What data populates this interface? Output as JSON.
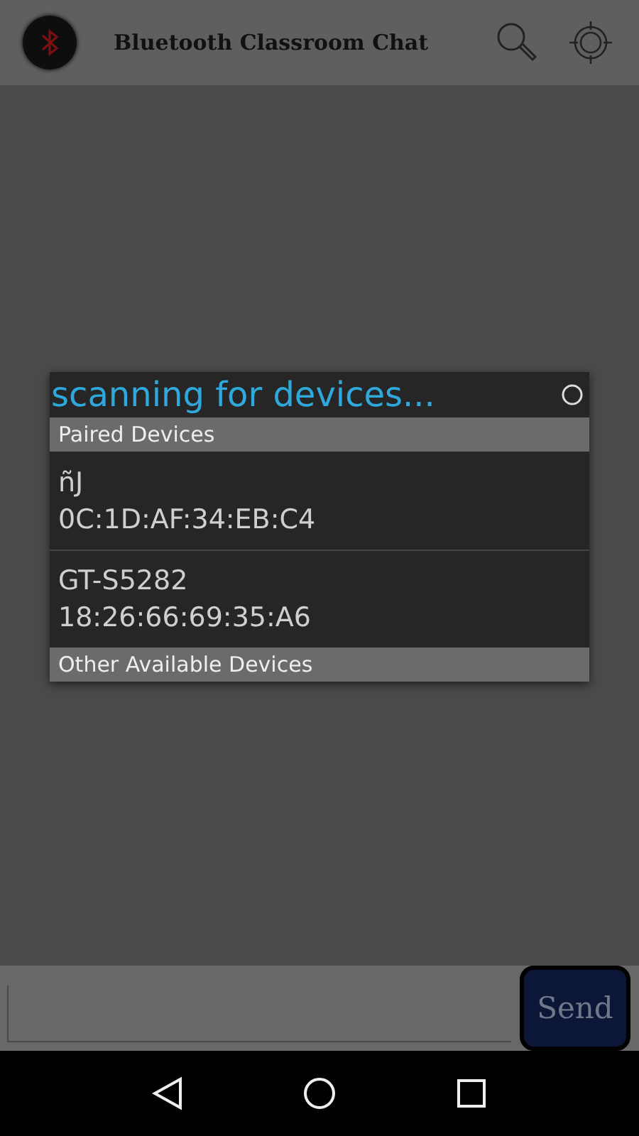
{
  "app_bar": {
    "title": "Bluetooth Classroom Chat"
  },
  "dialog": {
    "title": "scanning for devices...",
    "sections": [
      {
        "header": "Paired Devices",
        "devices": [
          {
            "name": "ñJ",
            "address": "0C:1D:AF:34:EB:C4"
          },
          {
            "name": "GT-S5282",
            "address": "18:26:66:69:35:A6"
          }
        ]
      },
      {
        "header": "Other Available Devices"
      }
    ]
  },
  "composer": {
    "send": "Send"
  }
}
